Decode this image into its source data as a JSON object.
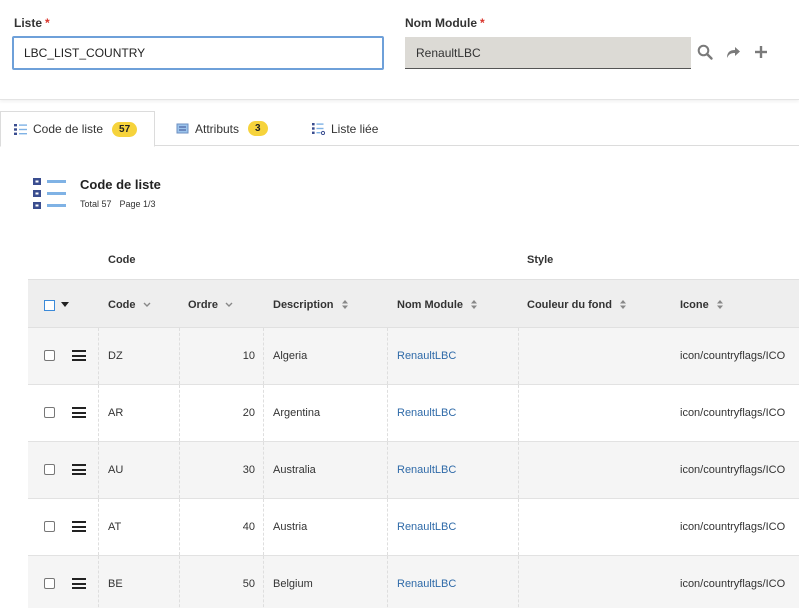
{
  "form": {
    "liste_label": "Liste",
    "liste_value": "LBC_LIST_COUNTRY",
    "module_label": "Nom Module",
    "module_value": "RenaultLBC",
    "required_mark": "*"
  },
  "toolbar": {
    "icons": [
      "search-icon",
      "share-arrow-icon",
      "plus-icon"
    ]
  },
  "tabs": [
    {
      "label": "Code de liste",
      "badge": "57",
      "icon": "list-icon"
    },
    {
      "label": "Attributs",
      "badge": "3",
      "icon": "attributes-icon"
    },
    {
      "label": "Liste liée",
      "badge": "",
      "icon": "linked-list-icon"
    }
  ],
  "section": {
    "title": "Code de liste",
    "total": "Total 57",
    "page": "Page 1/3"
  },
  "grid": {
    "groups": {
      "code": "Code",
      "style": "Style"
    },
    "columns": [
      "Code",
      "Ordre",
      "Description",
      "Nom Module",
      "Couleur du fond",
      "Icone"
    ],
    "rows": [
      {
        "code": "DZ",
        "ordre": "10",
        "description": "Algeria",
        "module": "RenaultLBC",
        "couleur": "",
        "icone": "icon/countryflags/ICO"
      },
      {
        "code": "AR",
        "ordre": "20",
        "description": "Argentina",
        "module": "RenaultLBC",
        "couleur": "",
        "icone": "icon/countryflags/ICO"
      },
      {
        "code": "AU",
        "ordre": "30",
        "description": "Australia",
        "module": "RenaultLBC",
        "couleur": "",
        "icone": "icon/countryflags/ICO"
      },
      {
        "code": "AT",
        "ordre": "40",
        "description": "Austria",
        "module": "RenaultLBC",
        "couleur": "",
        "icone": "icon/countryflags/ICO"
      },
      {
        "code": "BE",
        "ordre": "50",
        "description": "Belgium",
        "module": "RenaultLBC",
        "couleur": "",
        "icone": "icon/countryflags/ICO"
      }
    ]
  },
  "colors": {
    "accent": "#3b8ad9",
    "badge": "#f6d33c",
    "link": "#2f6aa8",
    "required": "#d9342b"
  }
}
